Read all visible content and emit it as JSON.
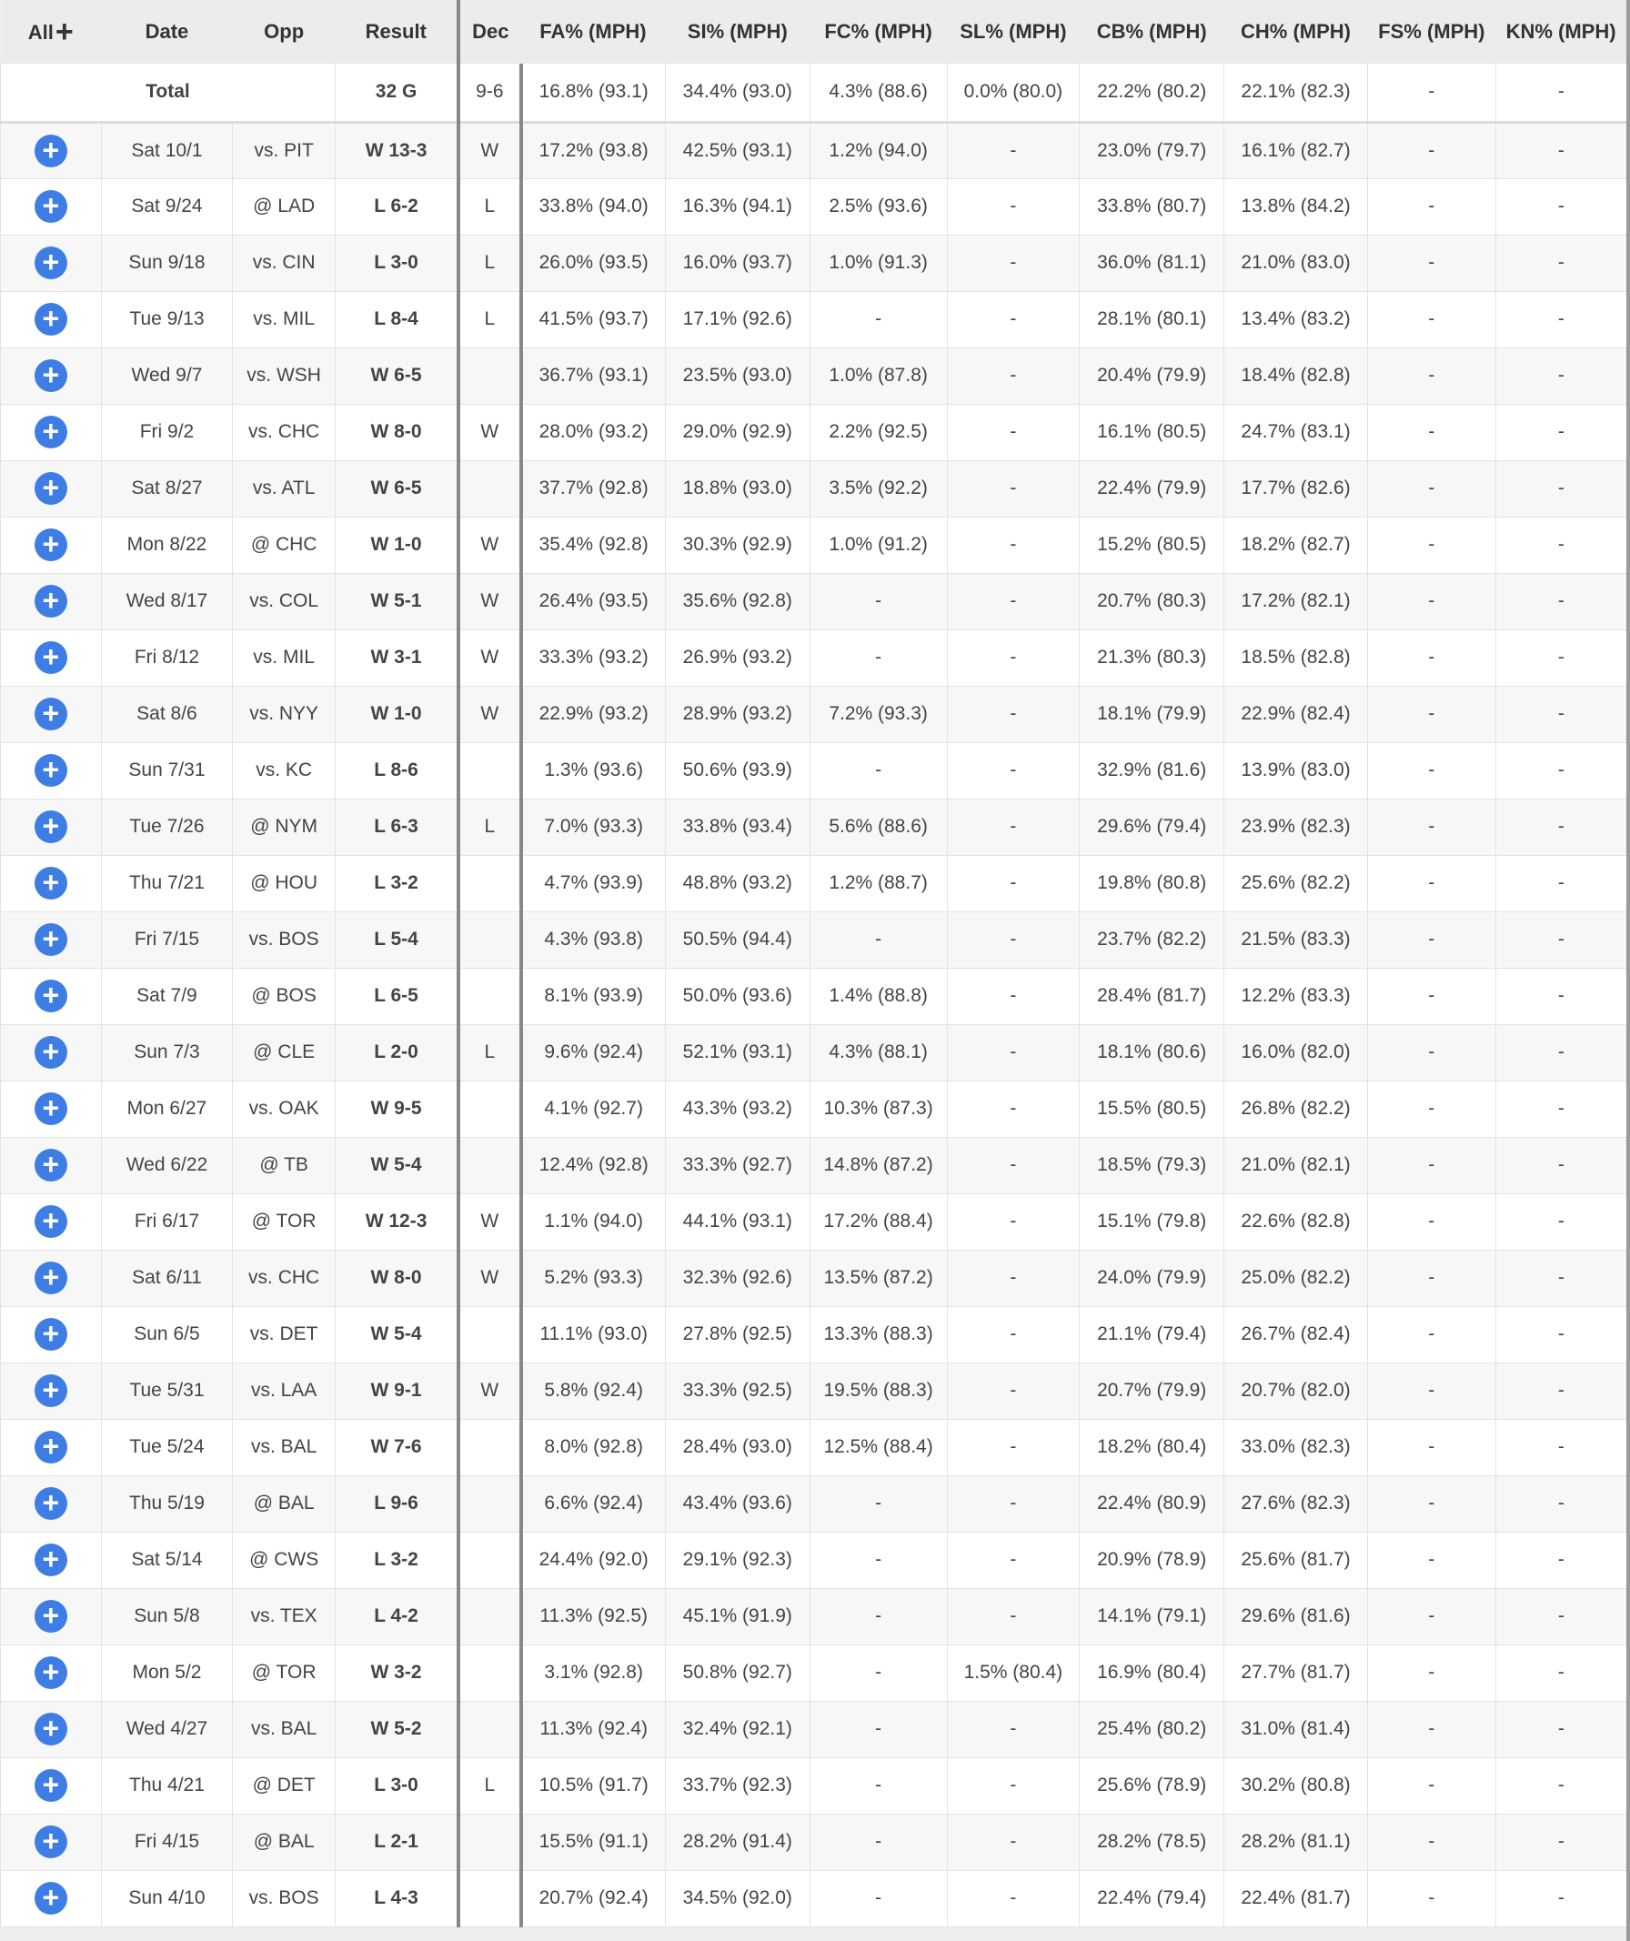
{
  "header": {
    "all_label": "All",
    "all_plus": "+",
    "columns": [
      "Date",
      "Opp",
      "Result",
      "Dec",
      "FA% (MPH)",
      "SI% (MPH)",
      "FC% (MPH)",
      "SL% (MPH)",
      "CB% (MPH)",
      "CH% (MPH)",
      "FS% (MPH)",
      "KN% (MPH)"
    ]
  },
  "total": {
    "label": "Total",
    "result": "32 G",
    "dec": "9-6",
    "pitches": [
      "16.8% (93.1)",
      "34.4% (93.0)",
      "4.3% (88.6)",
      "0.0% (80.0)",
      "22.2% (80.2)",
      "22.1% (82.3)",
      "-",
      "-"
    ]
  },
  "expand_symbol": "+",
  "games": [
    {
      "date": "Sat 10/1",
      "opp": "vs. PIT",
      "result": "W 13-3",
      "dec": "W",
      "pitches": [
        "17.2% (93.8)",
        "42.5% (93.1)",
        "1.2% (94.0)",
        "-",
        "23.0% (79.7)",
        "16.1% (82.7)",
        "-",
        "-"
      ]
    },
    {
      "date": "Sat 9/24",
      "opp": "@ LAD",
      "result": "L 6-2",
      "dec": "L",
      "pitches": [
        "33.8% (94.0)",
        "16.3% (94.1)",
        "2.5% (93.6)",
        "-",
        "33.8% (80.7)",
        "13.8% (84.2)",
        "-",
        "-"
      ]
    },
    {
      "date": "Sun 9/18",
      "opp": "vs. CIN",
      "result": "L 3-0",
      "dec": "L",
      "pitches": [
        "26.0% (93.5)",
        "16.0% (93.7)",
        "1.0% (91.3)",
        "-",
        "36.0% (81.1)",
        "21.0% (83.0)",
        "-",
        "-"
      ]
    },
    {
      "date": "Tue 9/13",
      "opp": "vs. MIL",
      "result": "L 8-4",
      "dec": "L",
      "pitches": [
        "41.5% (93.7)",
        "17.1% (92.6)",
        "-",
        "-",
        "28.1% (80.1)",
        "13.4% (83.2)",
        "-",
        "-"
      ]
    },
    {
      "date": "Wed 9/7",
      "opp": "vs. WSH",
      "result": "W 6-5",
      "dec": "",
      "pitches": [
        "36.7% (93.1)",
        "23.5% (93.0)",
        "1.0% (87.8)",
        "-",
        "20.4% (79.9)",
        "18.4% (82.8)",
        "-",
        "-"
      ]
    },
    {
      "date": "Fri 9/2",
      "opp": "vs. CHC",
      "result": "W 8-0",
      "dec": "W",
      "pitches": [
        "28.0% (93.2)",
        "29.0% (92.9)",
        "2.2% (92.5)",
        "-",
        "16.1% (80.5)",
        "24.7% (83.1)",
        "-",
        "-"
      ]
    },
    {
      "date": "Sat 8/27",
      "opp": "vs. ATL",
      "result": "W 6-5",
      "dec": "",
      "pitches": [
        "37.7% (92.8)",
        "18.8% (93.0)",
        "3.5% (92.2)",
        "-",
        "22.4% (79.9)",
        "17.7% (82.6)",
        "-",
        "-"
      ]
    },
    {
      "date": "Mon 8/22",
      "opp": "@ CHC",
      "result": "W 1-0",
      "dec": "W",
      "pitches": [
        "35.4% (92.8)",
        "30.3% (92.9)",
        "1.0% (91.2)",
        "-",
        "15.2% (80.5)",
        "18.2% (82.7)",
        "-",
        "-"
      ]
    },
    {
      "date": "Wed 8/17",
      "opp": "vs. COL",
      "result": "W 5-1",
      "dec": "W",
      "pitches": [
        "26.4% (93.5)",
        "35.6% (92.8)",
        "-",
        "-",
        "20.7% (80.3)",
        "17.2% (82.1)",
        "-",
        "-"
      ]
    },
    {
      "date": "Fri 8/12",
      "opp": "vs. MIL",
      "result": "W 3-1",
      "dec": "W",
      "pitches": [
        "33.3% (93.2)",
        "26.9% (93.2)",
        "-",
        "-",
        "21.3% (80.3)",
        "18.5% (82.8)",
        "-",
        "-"
      ]
    },
    {
      "date": "Sat 8/6",
      "opp": "vs. NYY",
      "result": "W 1-0",
      "dec": "W",
      "pitches": [
        "22.9% (93.2)",
        "28.9% (93.2)",
        "7.2% (93.3)",
        "-",
        "18.1% (79.9)",
        "22.9% (82.4)",
        "-",
        "-"
      ]
    },
    {
      "date": "Sun 7/31",
      "opp": "vs. KC",
      "result": "L 8-6",
      "dec": "",
      "pitches": [
        "1.3% (93.6)",
        "50.6% (93.9)",
        "-",
        "-",
        "32.9% (81.6)",
        "13.9% (83.0)",
        "-",
        "-"
      ]
    },
    {
      "date": "Tue 7/26",
      "opp": "@ NYM",
      "result": "L 6-3",
      "dec": "L",
      "pitches": [
        "7.0% (93.3)",
        "33.8% (93.4)",
        "5.6% (88.6)",
        "-",
        "29.6% (79.4)",
        "23.9% (82.3)",
        "-",
        "-"
      ]
    },
    {
      "date": "Thu 7/21",
      "opp": "@ HOU",
      "result": "L 3-2",
      "dec": "",
      "pitches": [
        "4.7% (93.9)",
        "48.8% (93.2)",
        "1.2% (88.7)",
        "-",
        "19.8% (80.8)",
        "25.6% (82.2)",
        "-",
        "-"
      ]
    },
    {
      "date": "Fri 7/15",
      "opp": "vs. BOS",
      "result": "L 5-4",
      "dec": "",
      "pitches": [
        "4.3% (93.8)",
        "50.5% (94.4)",
        "-",
        "-",
        "23.7% (82.2)",
        "21.5% (83.3)",
        "-",
        "-"
      ]
    },
    {
      "date": "Sat 7/9",
      "opp": "@ BOS",
      "result": "L 6-5",
      "dec": "",
      "pitches": [
        "8.1% (93.9)",
        "50.0% (93.6)",
        "1.4% (88.8)",
        "-",
        "28.4% (81.7)",
        "12.2% (83.3)",
        "-",
        "-"
      ]
    },
    {
      "date": "Sun 7/3",
      "opp": "@ CLE",
      "result": "L 2-0",
      "dec": "L",
      "pitches": [
        "9.6% (92.4)",
        "52.1% (93.1)",
        "4.3% (88.1)",
        "-",
        "18.1% (80.6)",
        "16.0% (82.0)",
        "-",
        "-"
      ]
    },
    {
      "date": "Mon 6/27",
      "opp": "vs. OAK",
      "result": "W 9-5",
      "dec": "",
      "pitches": [
        "4.1% (92.7)",
        "43.3% (93.2)",
        "10.3% (87.3)",
        "-",
        "15.5% (80.5)",
        "26.8% (82.2)",
        "-",
        "-"
      ]
    },
    {
      "date": "Wed 6/22",
      "opp": "@ TB",
      "result": "W 5-4",
      "dec": "",
      "pitches": [
        "12.4% (92.8)",
        "33.3% (92.7)",
        "14.8% (87.2)",
        "-",
        "18.5% (79.3)",
        "21.0% (82.1)",
        "-",
        "-"
      ]
    },
    {
      "date": "Fri 6/17",
      "opp": "@ TOR",
      "result": "W 12-3",
      "dec": "W",
      "pitches": [
        "1.1% (94.0)",
        "44.1% (93.1)",
        "17.2% (88.4)",
        "-",
        "15.1% (79.8)",
        "22.6% (82.8)",
        "-",
        "-"
      ]
    },
    {
      "date": "Sat 6/11",
      "opp": "vs. CHC",
      "result": "W 8-0",
      "dec": "W",
      "pitches": [
        "5.2% (93.3)",
        "32.3% (92.6)",
        "13.5% (87.2)",
        "-",
        "24.0% (79.9)",
        "25.0% (82.2)",
        "-",
        "-"
      ]
    },
    {
      "date": "Sun 6/5",
      "opp": "vs. DET",
      "result": "W 5-4",
      "dec": "",
      "pitches": [
        "11.1% (93.0)",
        "27.8% (92.5)",
        "13.3% (88.3)",
        "-",
        "21.1% (79.4)",
        "26.7% (82.4)",
        "-",
        "-"
      ]
    },
    {
      "date": "Tue 5/31",
      "opp": "vs. LAA",
      "result": "W 9-1",
      "dec": "W",
      "pitches": [
        "5.8% (92.4)",
        "33.3% (92.5)",
        "19.5% (88.3)",
        "-",
        "20.7% (79.9)",
        "20.7% (82.0)",
        "-",
        "-"
      ]
    },
    {
      "date": "Tue 5/24",
      "opp": "vs. BAL",
      "result": "W 7-6",
      "dec": "",
      "pitches": [
        "8.0% (92.8)",
        "28.4% (93.0)",
        "12.5% (88.4)",
        "-",
        "18.2% (80.4)",
        "33.0% (82.3)",
        "-",
        "-"
      ]
    },
    {
      "date": "Thu 5/19",
      "opp": "@ BAL",
      "result": "L 9-6",
      "dec": "",
      "pitches": [
        "6.6% (92.4)",
        "43.4% (93.6)",
        "-",
        "-",
        "22.4% (80.9)",
        "27.6% (82.3)",
        "-",
        "-"
      ]
    },
    {
      "date": "Sat 5/14",
      "opp": "@ CWS",
      "result": "L 3-2",
      "dec": "",
      "pitches": [
        "24.4% (92.0)",
        "29.1% (92.3)",
        "-",
        "-",
        "20.9% (78.9)",
        "25.6% (81.7)",
        "-",
        "-"
      ]
    },
    {
      "date": "Sun 5/8",
      "opp": "vs. TEX",
      "result": "L 4-2",
      "dec": "",
      "pitches": [
        "11.3% (92.5)",
        "45.1% (91.9)",
        "-",
        "-",
        "14.1% (79.1)",
        "29.6% (81.6)",
        "-",
        "-"
      ]
    },
    {
      "date": "Mon 5/2",
      "opp": "@ TOR",
      "result": "W 3-2",
      "dec": "",
      "pitches": [
        "3.1% (92.8)",
        "50.8% (92.7)",
        "-",
        "1.5% (80.4)",
        "16.9% (80.4)",
        "27.7% (81.7)",
        "-",
        "-"
      ]
    },
    {
      "date": "Wed 4/27",
      "opp": "vs. BAL",
      "result": "W 5-2",
      "dec": "",
      "pitches": [
        "11.3% (92.4)",
        "32.4% (92.1)",
        "-",
        "-",
        "25.4% (80.2)",
        "31.0% (81.4)",
        "-",
        "-"
      ]
    },
    {
      "date": "Thu 4/21",
      "opp": "@ DET",
      "result": "L 3-0",
      "dec": "L",
      "pitches": [
        "10.5% (91.7)",
        "33.7% (92.3)",
        "-",
        "-",
        "25.6% (78.9)",
        "30.2% (80.8)",
        "-",
        "-"
      ]
    },
    {
      "date": "Fri 4/15",
      "opp": "@ BAL",
      "result": "L 2-1",
      "dec": "",
      "pitches": [
        "15.5% (91.1)",
        "28.2% (91.4)",
        "-",
        "-",
        "28.2% (78.5)",
        "28.2% (81.1)",
        "-",
        "-"
      ]
    },
    {
      "date": "Sun 4/10",
      "opp": "vs. BOS",
      "result": "L 4-3",
      "dec": "",
      "pitches": [
        "20.7% (92.4)",
        "34.5% (92.0)",
        "-",
        "-",
        "22.4% (79.4)",
        "22.4% (81.7)",
        "-",
        "-"
      ]
    }
  ]
}
